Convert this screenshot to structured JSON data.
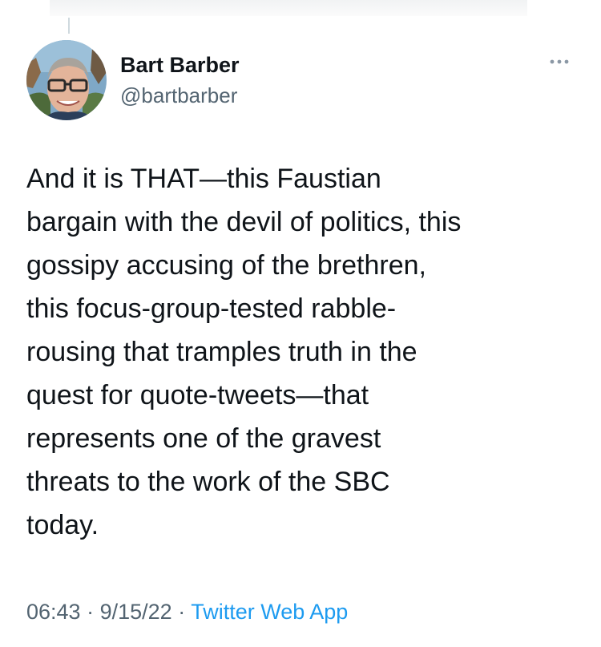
{
  "author": {
    "name": "Bart Barber",
    "handle": "@bartbarber"
  },
  "tweet": {
    "lines": [
      "And it is THAT—this Faustian",
      "bargain with the devil of politics, this",
      "gossipy accusing of the brethren,",
      "this focus-group-tested rabble-",
      "rousing that tramples truth in the",
      "quest for quote-tweets—that",
      "represents one of the gravest",
      "threats to the work of the SBC",
      "today."
    ]
  },
  "meta": {
    "time": "06:43",
    "separator": "·",
    "date": "9/15/22",
    "source": "Twitter Web App"
  },
  "colors": {
    "text": "#0f1419",
    "secondary": "#536471",
    "link": "#1d9bf0",
    "thread_line": "#cfd9de"
  },
  "icons": {
    "more": "more-horizontal-icon"
  }
}
